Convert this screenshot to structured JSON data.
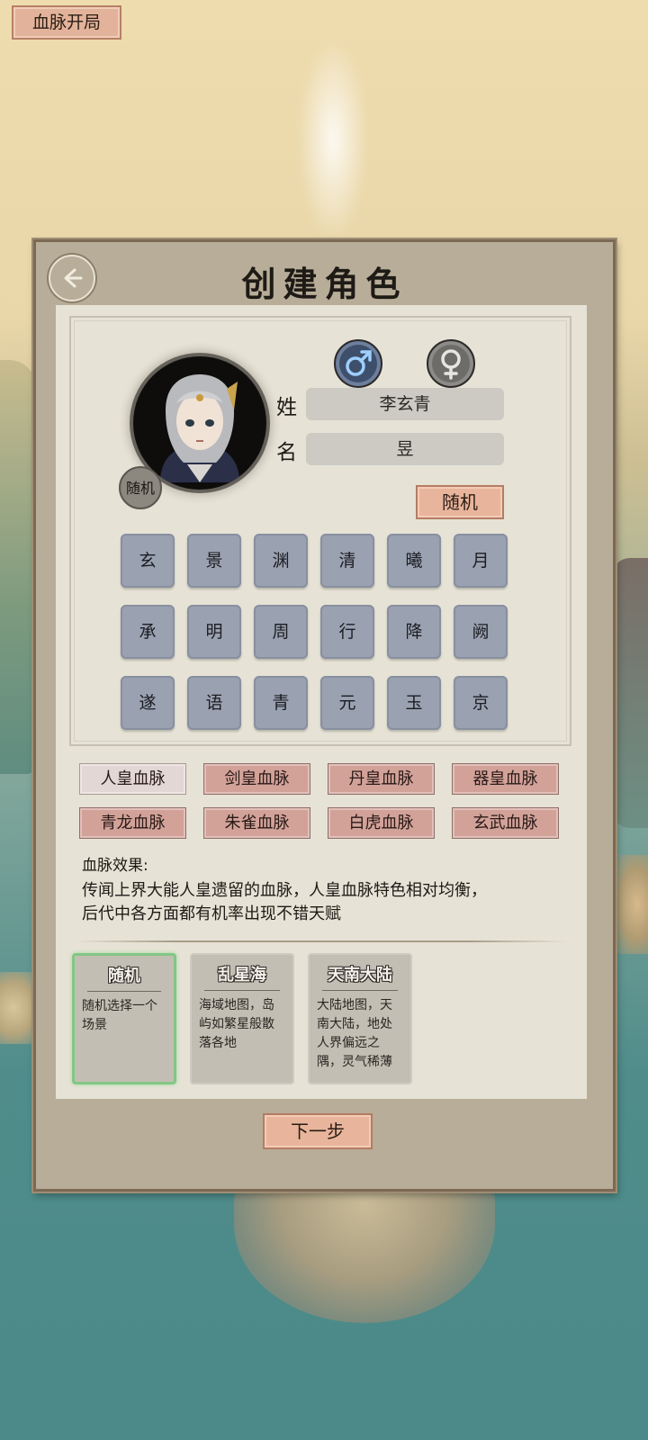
{
  "top_tag": "血脉开局",
  "title": "创建角色",
  "avatar": {
    "random_badge": "随机"
  },
  "form": {
    "surname_label": "姓",
    "surname_value": "李玄青",
    "given_label": "名",
    "given_value": "昱",
    "random_button": "随机"
  },
  "gender": {
    "male_icon": "male-symbol",
    "female_icon": "female-symbol",
    "selected": "male"
  },
  "characters": [
    [
      "玄",
      "景",
      "渊",
      "清",
      "曦",
      "月"
    ],
    [
      "承",
      "明",
      "周",
      "行",
      "降",
      "阙"
    ],
    [
      "遂",
      "语",
      "青",
      "元",
      "玉",
      "京"
    ]
  ],
  "bloodlines": [
    {
      "label": "人皇血脉",
      "selected": true
    },
    {
      "label": "剑皇血脉",
      "selected": false
    },
    {
      "label": "丹皇血脉",
      "selected": false
    },
    {
      "label": "器皇血脉",
      "selected": false
    },
    {
      "label": "青龙血脉",
      "selected": false
    },
    {
      "label": "朱雀血脉",
      "selected": false
    },
    {
      "label": "白虎血脉",
      "selected": false
    },
    {
      "label": "玄武血脉",
      "selected": false
    }
  ],
  "effect": {
    "label": "血脉效果:",
    "text": "传闻上界大能人皇遗留的血脉，人皇血脉特色相对均衡，后代中各方面都有机率出现不错天赋"
  },
  "scenes": [
    {
      "title": "随机",
      "desc": "随机选择一个场景",
      "selected": true
    },
    {
      "title": "乱星海",
      "desc": "海域地图，岛屿如繁星般散落各地",
      "selected": false
    },
    {
      "title": "天南大陆",
      "desc": "大陆地图，天南大陆，地处人界偏远之隅，灵气稀薄",
      "selected": false
    }
  ],
  "next_button": "下一步",
  "colors": {
    "accent_button": "#e8b59c",
    "selected_scene_border": "#83c785",
    "panel": "#b8ad98"
  }
}
